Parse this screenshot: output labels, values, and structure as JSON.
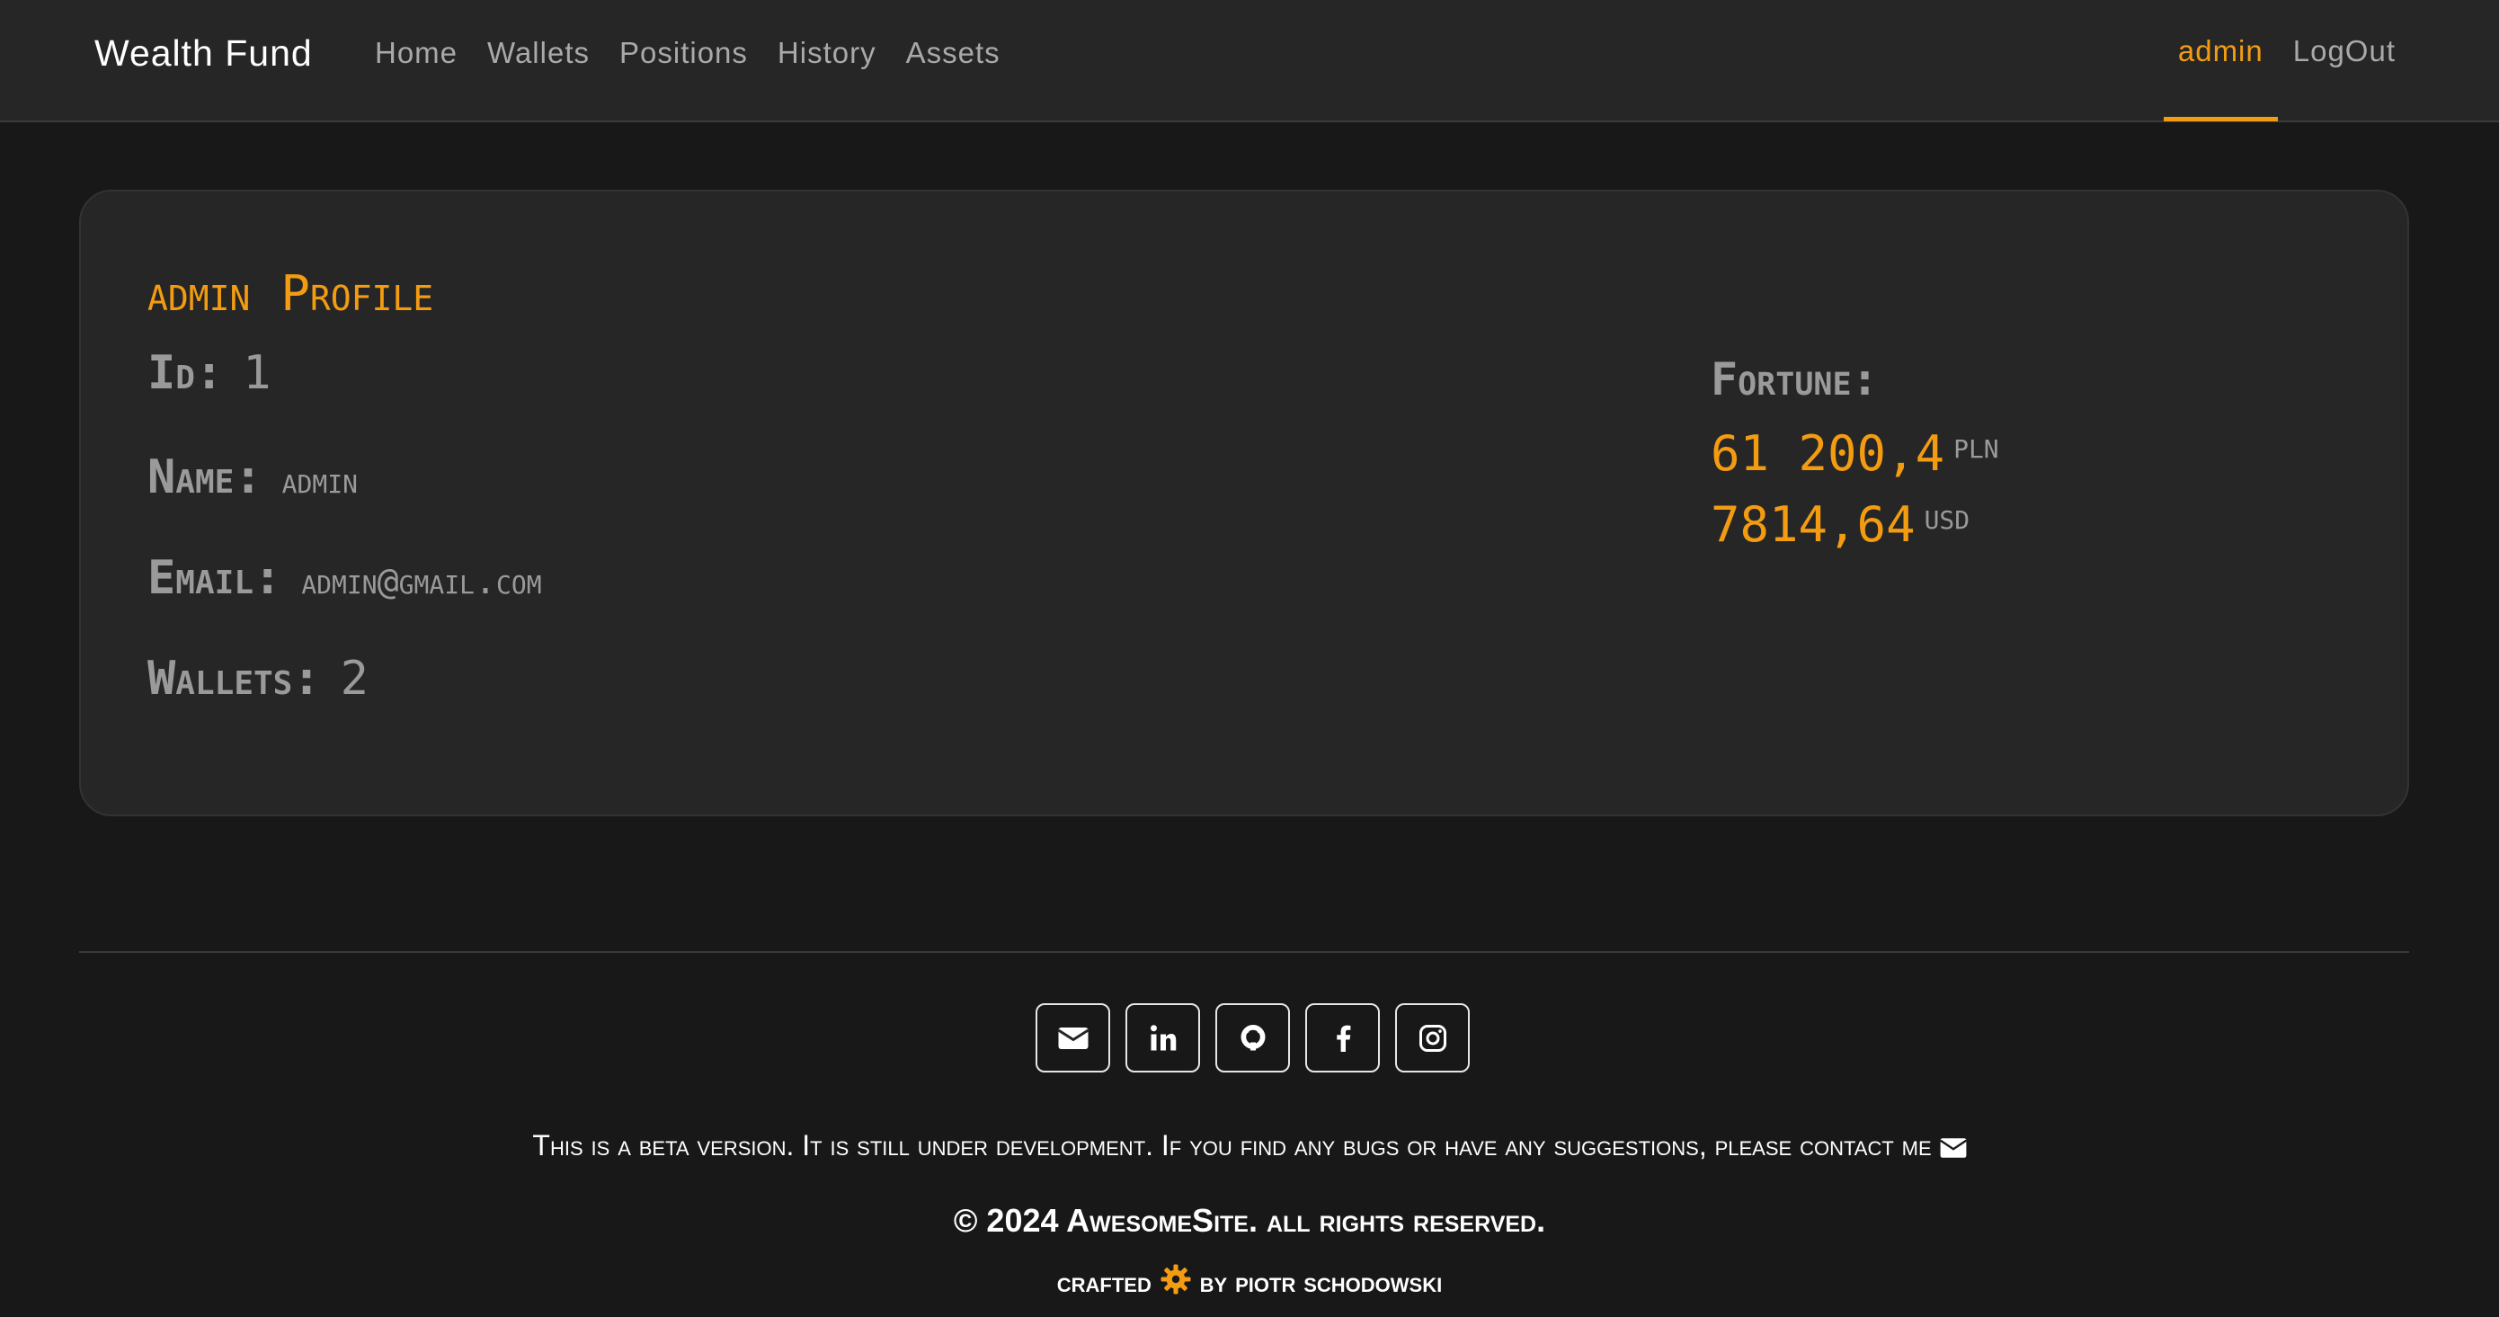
{
  "navbar": {
    "brand": "Wealth Fund",
    "links": [
      "Home",
      "Wallets",
      "Positions",
      "History",
      "Assets"
    ],
    "user": "admin",
    "logout": "LogOut",
    "accent_color": "#f39c12"
  },
  "profile": {
    "username": "admin",
    "title_suffix": "Profile",
    "id_label": "Id:",
    "id_value": "1",
    "name_label": "Name:",
    "name_value": "admin",
    "email_label": "Email:",
    "email_value": "admin@gmail.com",
    "wallets_label": "Wallets:",
    "wallets_value": "2"
  },
  "fortune": {
    "label": "Fortune:",
    "amounts": [
      {
        "value": "61 200,4",
        "currency": "PLN"
      },
      {
        "value": "7814,64",
        "currency": "USD"
      }
    ]
  },
  "footer": {
    "socials": [
      "envelope-icon",
      "linkedin-icon",
      "github-icon",
      "facebook-icon",
      "instagram-icon"
    ],
    "beta_text": "This is a beta version. It is still under development. If you find any bugs or have any suggestions, please contact me",
    "copyright": "© 2024 AwesomeSite. all rights reserved.",
    "crafted_prefix": "crafted",
    "crafted_suffix": "by piotr schodowski"
  }
}
